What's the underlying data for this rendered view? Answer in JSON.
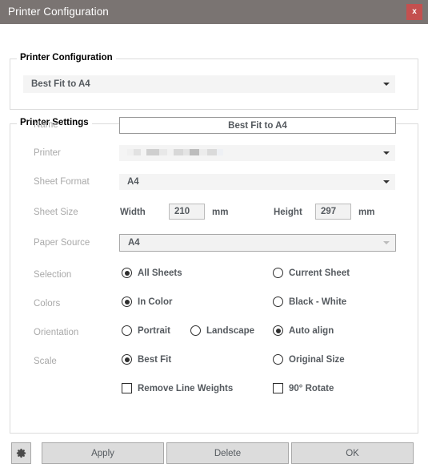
{
  "window": {
    "title": "Printer Configuration",
    "close_label": "x",
    "close_icon": "close-icon",
    "titlebar_color": "#7a7472",
    "close_color": "#c4504f"
  },
  "config_group": {
    "title": "Printer Configuration",
    "preset": {
      "value": "Best Fit to A4",
      "arrow_icon": "chevron-down-icon"
    }
  },
  "settings_group": {
    "title": "Printer Settings",
    "name": {
      "label": "Name",
      "value": "Best Fit to A4"
    },
    "printer": {
      "label": "Printer",
      "value": "",
      "redacted": true,
      "arrow_icon": "chevron-down-icon"
    },
    "sheet_format": {
      "label": "Sheet Format",
      "value": "A4",
      "arrow_icon": "chevron-down-icon"
    },
    "sheet_size": {
      "label": "Sheet Size",
      "width_label": "Width",
      "width_value": "210",
      "width_unit": "mm",
      "height_label": "Height",
      "height_value": "297",
      "height_unit": "mm"
    },
    "paper_source": {
      "label": "Paper Source",
      "value": "A4",
      "arrow_icon": "chevron-down-icon",
      "disabled": true
    },
    "selection": {
      "label": "Selection",
      "options": [
        {
          "label": "All Sheets",
          "checked": true
        },
        {
          "label": "Current Sheet",
          "checked": false
        }
      ]
    },
    "colors": {
      "label": "Colors",
      "options": [
        {
          "label": "In Color",
          "checked": true
        },
        {
          "label": "Black - White",
          "checked": false
        }
      ]
    },
    "orientation": {
      "label": "Orientation",
      "options": [
        {
          "label": "Portrait",
          "checked": false
        },
        {
          "label": "Landscape",
          "checked": false
        },
        {
          "label": "Auto align",
          "checked": true
        }
      ]
    },
    "scale": {
      "label": "Scale",
      "options": [
        {
          "label": "Best Fit",
          "checked": true
        },
        {
          "label": "Original Size",
          "checked": false
        }
      ]
    },
    "checkboxes": [
      {
        "label": "Remove Line Weights",
        "checked": false
      },
      {
        "label": "90° Rotate",
        "checked": false
      }
    ]
  },
  "footer": {
    "settings_icon": "gear-icon",
    "buttons": [
      {
        "label": "Apply"
      },
      {
        "label": "Delete"
      },
      {
        "label": "OK"
      }
    ]
  }
}
